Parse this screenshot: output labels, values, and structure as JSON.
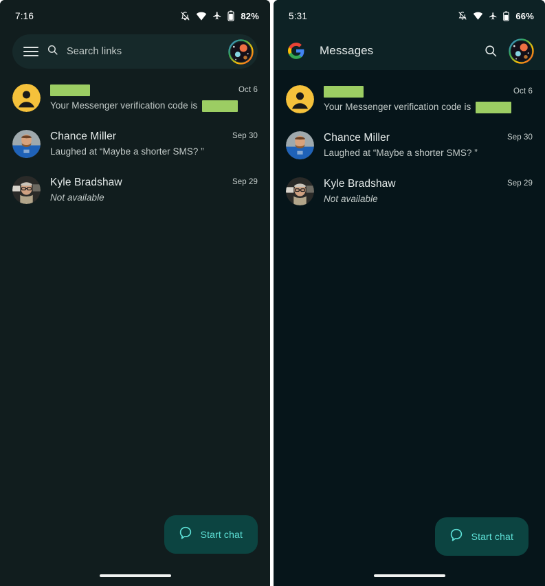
{
  "panels": {
    "left": {
      "status": {
        "time": "7:16",
        "battery_percent": "82%",
        "icons": [
          "notifications-off-icon",
          "wifi-icon",
          "airplane-mode-icon",
          "battery-icon"
        ]
      },
      "search": {
        "placeholder": "Search links",
        "menu_icon": "hamburger-menu-icon",
        "search_icon": "search-icon",
        "avatar_icon": "account-avatar"
      },
      "fab": {
        "label": "Start chat",
        "icon": "chat-bubble-icon"
      },
      "conversations": [
        {
          "name": "",
          "name_redacted": true,
          "snippet_prefix": "Your Messenger verification code is",
          "snippet_redacted": true,
          "date": "Oct 6",
          "avatar": "default-person-avatar",
          "italic": false
        },
        {
          "name": "Chance Miller",
          "name_redacted": false,
          "snippet_prefix": "Laughed at “Maybe a shorter SMS? ”",
          "snippet_redacted": false,
          "date": "Sep 30",
          "avatar": "photo-avatar-blue-shirt",
          "italic": false
        },
        {
          "name": "Kyle Bradshaw",
          "name_redacted": false,
          "snippet_prefix": "Not available",
          "snippet_redacted": false,
          "date": "Sep 29",
          "avatar": "photo-avatar-glasses",
          "italic": true
        }
      ]
    },
    "right": {
      "status": {
        "time": "5:31",
        "battery_percent": "66%",
        "icons": [
          "notifications-off-icon",
          "wifi-icon",
          "airplane-mode-icon",
          "battery-icon"
        ]
      },
      "appbar": {
        "title": "Messages",
        "logo_icon": "google-g-logo",
        "search_icon": "search-icon",
        "avatar_icon": "account-avatar"
      },
      "fab": {
        "label": "Start chat",
        "icon": "chat-bubble-icon"
      },
      "conversations": [
        {
          "name": "",
          "name_redacted": true,
          "snippet_prefix": "Your Messenger verification code is",
          "snippet_redacted": true,
          "date": "Oct 6",
          "avatar": "default-person-avatar",
          "italic": false
        },
        {
          "name": "Chance Miller",
          "name_redacted": false,
          "snippet_prefix": "Laughed at “Maybe a shorter SMS? ”",
          "snippet_redacted": false,
          "date": "Sep 30",
          "avatar": "photo-avatar-blue-shirt",
          "italic": false
        },
        {
          "name": "Kyle Bradshaw",
          "name_redacted": false,
          "snippet_prefix": "Not available",
          "snippet_redacted": false,
          "date": "Sep 29",
          "avatar": "photo-avatar-glasses",
          "italic": true
        }
      ]
    }
  },
  "colors": {
    "left_background": "#111d1e",
    "right_background": "#06151a",
    "right_appbar": "#0d2225",
    "search_field": "#16292a",
    "fab_background": "#0c4441",
    "fab_accent": "#5de0d6",
    "redaction_green": "#9ccd63",
    "default_avatar_yellow": "#f5c13b",
    "text_primary": "#e6eceb",
    "text_secondary": "#c2cac8"
  }
}
